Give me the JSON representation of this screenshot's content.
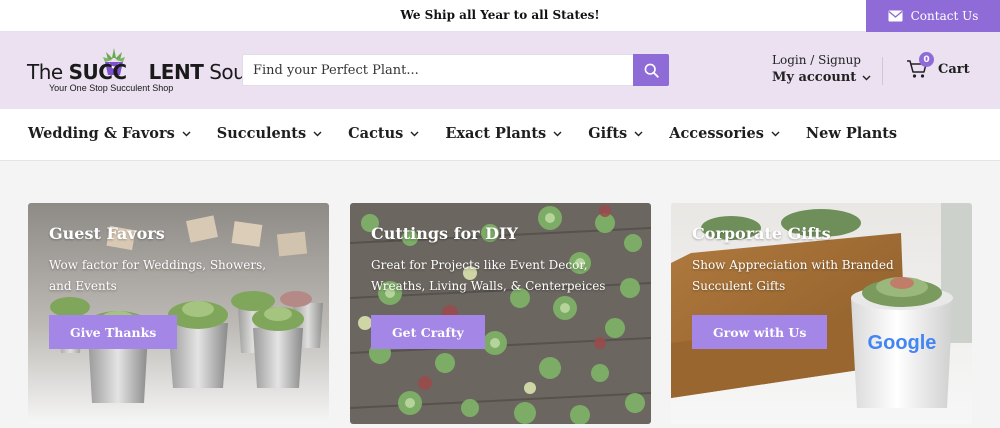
{
  "topbar": {
    "shipping_message": "We Ship all Year to all States!",
    "contact_label": "Contact Us"
  },
  "header": {
    "logo": {
      "brand_prefix": "The ",
      "brand_bold_1": "SUCC",
      "brand_bold_2": "LENT",
      "brand_suffix": " Source",
      "tagline": "Your One Stop Succulent Shop"
    },
    "search": {
      "placeholder": "Find your Perfect Plant..."
    },
    "account": {
      "login_label": "Login / Signup",
      "my_account_label": "My account"
    },
    "cart": {
      "label": "Cart",
      "count": "0"
    }
  },
  "nav": {
    "items": [
      {
        "label": "Wedding & Favors",
        "has_dropdown": true
      },
      {
        "label": "Succulents",
        "has_dropdown": true
      },
      {
        "label": "Cactus",
        "has_dropdown": true
      },
      {
        "label": "Exact Plants",
        "has_dropdown": true
      },
      {
        "label": "Gifts",
        "has_dropdown": true
      },
      {
        "label": "Accessories",
        "has_dropdown": true
      },
      {
        "label": "New Plants",
        "has_dropdown": false
      }
    ]
  },
  "cards": [
    {
      "title": "Guest Favors",
      "description": "Wow factor for Weddings, Showers, and Events",
      "button": "Give Thanks"
    },
    {
      "title": "Cuttings for DIY",
      "description": "Great for Projects like Event Decor, Wreaths, Living Walls, & Centerpeices",
      "button": "Get Crafty"
    },
    {
      "title": "Corporate Gifts",
      "description": "Show Appreciation with Branded Succulent Gifts",
      "button": "Grow with Us",
      "pot_logo": "Google"
    }
  ],
  "colors": {
    "accent": "#8f6bd8",
    "button": "#a386e6",
    "header_bg": "#ebe1f1"
  }
}
